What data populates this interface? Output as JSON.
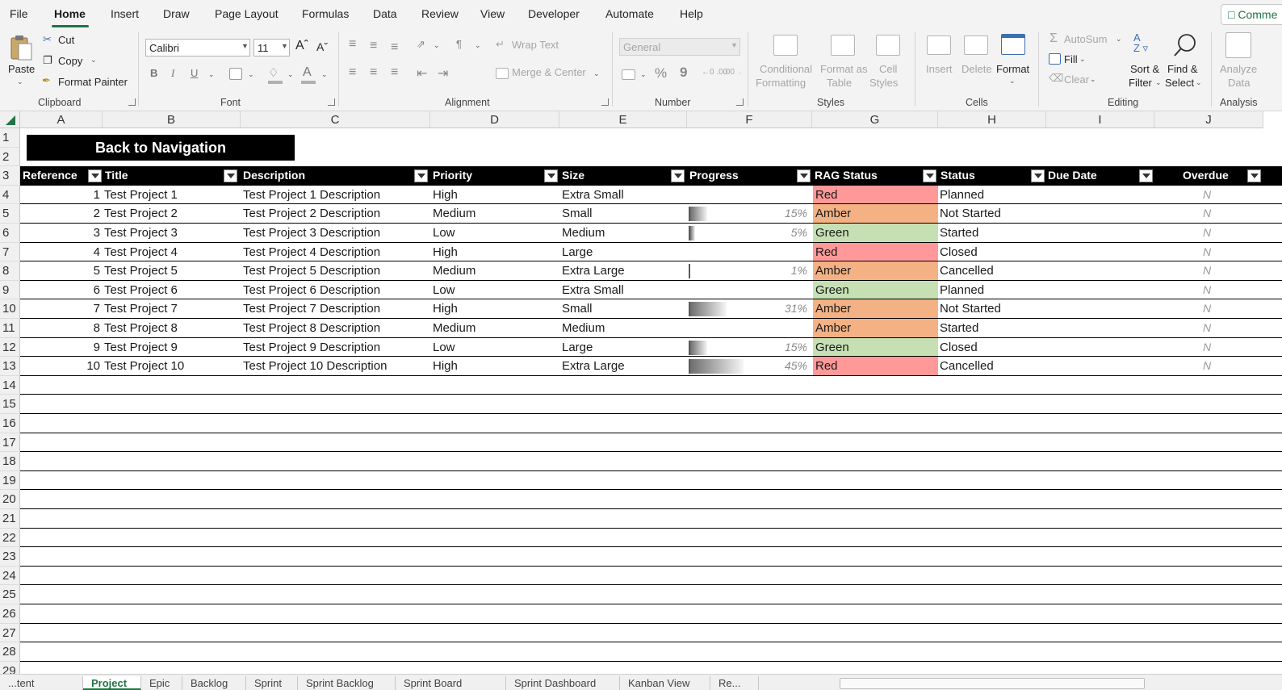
{
  "menu": {
    "items": [
      "File",
      "Home",
      "Insert",
      "Draw",
      "Page Layout",
      "Formulas",
      "Data",
      "Review",
      "View",
      "Developer",
      "Automate",
      "Help"
    ],
    "active": "Home",
    "comments_label": "Comme"
  },
  "ribbon": {
    "clipboard": {
      "paste": "Paste",
      "cut": "Cut",
      "copy": "Copy",
      "format_painter": "Format Painter",
      "label": "Clipboard"
    },
    "font": {
      "name": "Calibri",
      "size": "11",
      "bold": "B",
      "italic": "I",
      "underline": "U",
      "font_color_glyph": "A",
      "label": "Font"
    },
    "alignment": {
      "wrap_text": "Wrap Text",
      "merge_center": "Merge & Center",
      "label": "Alignment"
    },
    "number": {
      "format": "General",
      "percent": "%",
      "comma": "9",
      "inc_decimal": "←0 .00",
      "dec_decimal": ".00 →0",
      "label": "Number"
    },
    "styles": {
      "conditional_1": "Conditional",
      "conditional_2": "Formatting",
      "format_table_1": "Format as",
      "format_table_2": "Table",
      "cell_styles_1": "Cell",
      "cell_styles_2": "Styles",
      "label": "Styles"
    },
    "cells": {
      "insert": "Insert",
      "delete": "Delete",
      "format": "Format",
      "label": "Cells"
    },
    "editing": {
      "autosum": "AutoSum",
      "fill": "Fill",
      "clear": "Clear",
      "sort_1": "Sort &",
      "sort_2": "Filter",
      "find_1": "Find &",
      "find_2": "Select",
      "label": "Editing"
    },
    "analysis": {
      "analyze_1": "Analyze",
      "analyze_2": "Data",
      "label": "Analysis"
    }
  },
  "grid": {
    "columns": [
      "A",
      "B",
      "C",
      "D",
      "E",
      "F",
      "G",
      "H",
      "I",
      "J"
    ],
    "row_numbers": [
      "1",
      "2",
      "3",
      "4",
      "5",
      "6",
      "7",
      "8",
      "9",
      "10",
      "11",
      "12",
      "13",
      "14",
      "15",
      "16",
      "17",
      "18",
      "19",
      "20",
      "21",
      "22",
      "23",
      "24",
      "25",
      "26",
      "27",
      "28",
      "29"
    ],
    "nav_button": "Back to Navigation",
    "headers": [
      "Reference",
      "Title",
      "Description",
      "Priority",
      "Size",
      "Progress",
      "RAG Status",
      "Status",
      "Due Date",
      "Overdue"
    ],
    "rows": [
      {
        "ref": "1",
        "title": "Test Project 1",
        "desc": "Test Project 1 Description",
        "priority": "High",
        "size": "Extra Small",
        "progress": 0,
        "progress_label": "",
        "rag": "Red",
        "status": "Planned",
        "overdue": "N"
      },
      {
        "ref": "2",
        "title": "Test Project 2",
        "desc": "Test Project 2 Description",
        "priority": "Medium",
        "size": "Small",
        "progress": 15,
        "progress_label": "15%",
        "rag": "Amber",
        "status": "Not Started",
        "overdue": "N"
      },
      {
        "ref": "3",
        "title": "Test Project 3",
        "desc": "Test Project 3 Description",
        "priority": "Low",
        "size": "Medium",
        "progress": 5,
        "progress_label": "5%",
        "rag": "Green",
        "status": "Started",
        "overdue": "N"
      },
      {
        "ref": "4",
        "title": "Test Project 4",
        "desc": "Test Project 4 Description",
        "priority": "High",
        "size": "Large",
        "progress": 0,
        "progress_label": "",
        "rag": "Red",
        "status": "Closed",
        "overdue": "N"
      },
      {
        "ref": "5",
        "title": "Test Project 5",
        "desc": "Test Project 5 Description",
        "priority": "Medium",
        "size": "Extra Large",
        "progress": 1,
        "progress_label": "1%",
        "rag": "Amber",
        "status": "Cancelled",
        "overdue": "N"
      },
      {
        "ref": "6",
        "title": "Test Project 6",
        "desc": "Test Project 6 Description",
        "priority": "Low",
        "size": "Extra Small",
        "progress": 0,
        "progress_label": "",
        "rag": "Green",
        "status": "Planned",
        "overdue": "N"
      },
      {
        "ref": "7",
        "title": "Test Project 7",
        "desc": "Test Project 7 Description",
        "priority": "High",
        "size": "Small",
        "progress": 31,
        "progress_label": "31%",
        "rag": "Amber",
        "status": "Not Started",
        "overdue": "N"
      },
      {
        "ref": "8",
        "title": "Test Project 8",
        "desc": "Test Project 8 Description",
        "priority": "Medium",
        "size": "Medium",
        "progress": 0,
        "progress_label": "",
        "rag": "Amber",
        "status": "Started",
        "overdue": "N"
      },
      {
        "ref": "9",
        "title": "Test Project 9",
        "desc": "Test Project 9 Description",
        "priority": "Low",
        "size": "Large",
        "progress": 15,
        "progress_label": "15%",
        "rag": "Green",
        "status": "Closed",
        "overdue": "N"
      },
      {
        "ref": "10",
        "title": "Test Project 10",
        "desc": "Test Project 10 Description",
        "priority": "High",
        "size": "Extra Large",
        "progress": 45,
        "progress_label": "45%",
        "rag": "Red",
        "status": "Cancelled",
        "overdue": "N"
      }
    ],
    "rag_colors": {
      "Red": "#ff9999",
      "Amber": "#f4b183",
      "Green": "#c6e0b4"
    }
  },
  "sheet_tabs": {
    "items": [
      "...tent",
      "Project",
      "Epic",
      "Backlog",
      "Sprint",
      "Sprint Backlog",
      "Sprint Board",
      "Sprint Dashboard",
      "Kanban View",
      "Re..."
    ],
    "active": "Project"
  },
  "colors": {
    "accent": "#217346",
    "header_bg": "#000000"
  }
}
